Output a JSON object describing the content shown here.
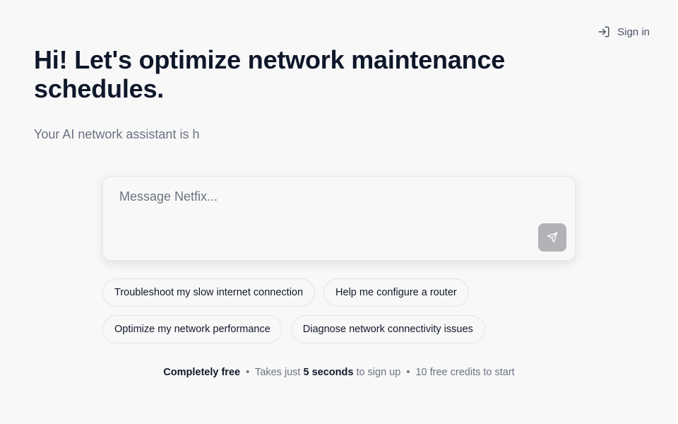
{
  "header": {
    "signin_label": "Sign in",
    "signin_icon": "log-in-icon"
  },
  "hero": {
    "title": "Hi! Let's optimize network maintenance schedules.",
    "subtitle": "Your AI network assistant is h"
  },
  "composer": {
    "placeholder": "Message Netfix...",
    "value": "",
    "send_icon": "send-icon"
  },
  "suggestions": [
    "Troubleshoot my slow internet connection",
    "Help me configure a router",
    "Optimize my network performance",
    "Diagnose network connectivity issues"
  ],
  "footer": {
    "part1_strong": "Completely free",
    "separator": "•",
    "part2_prefix": "Takes just",
    "part2_strong": "5 seconds",
    "part2_suffix": "to sign up",
    "part3": "10 free credits to start"
  },
  "colors": {
    "background": "#f8f8f9",
    "text": "#0f172a",
    "muted": "#6b7280",
    "send_button": "#b3b3b7"
  }
}
